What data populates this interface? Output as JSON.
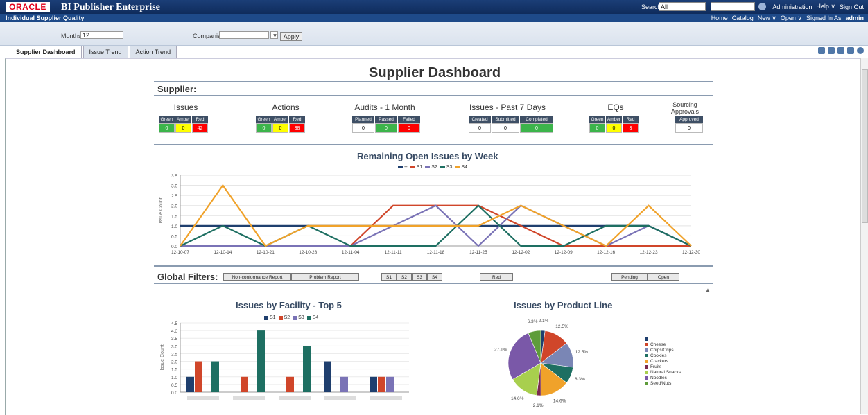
{
  "app": {
    "logo": "ORACLE",
    "product": "BI Publisher Enterprise",
    "search_label": "Search",
    "search_scope": "All",
    "top_links": [
      "Administration",
      "Help ∨",
      "Sign Out"
    ]
  },
  "report": {
    "title": "Individual Supplier Quality",
    "nav_links": [
      "Home",
      "Catalog",
      "New ∨",
      "Open ∨",
      "Signed In As"
    ],
    "user": "admin"
  },
  "params": {
    "months_label": "Months",
    "months_value": "12",
    "companies_label": "Companies",
    "apply_label": "Apply"
  },
  "tabs": [
    "Supplier Dashboard",
    "Issue Trend",
    "Action Trend"
  ],
  "dashboard": {
    "title": "Supplier Dashboard",
    "supplier_label": "Supplier:",
    "kpis": [
      {
        "title": "Issues",
        "heads": [
          "Green",
          "Amber",
          "Red"
        ],
        "values": [
          "0",
          "0",
          "42"
        ]
      },
      {
        "title": "Actions",
        "heads": [
          "Green",
          "Amber",
          "Red"
        ],
        "values": [
          "0",
          "0",
          "38"
        ]
      },
      {
        "title": "Audits - 1 Month",
        "heads": [
          "Planned",
          "Passed",
          "Failed"
        ],
        "values": [
          "0",
          "0",
          "0"
        ]
      },
      {
        "title": "Issues - Past 7 Days",
        "heads": [
          "Created",
          "Submitted",
          "Completed"
        ],
        "values": [
          "0",
          "0",
          "0"
        ]
      },
      {
        "title": "EQs",
        "heads": [
          "Green",
          "Amber",
          "Red"
        ],
        "values": [
          "0",
          "0",
          "3"
        ]
      },
      {
        "title": "Sourcing Approvals",
        "heads": [
          "Approved"
        ],
        "values": [
          "0"
        ]
      }
    ],
    "global_filters_label": "Global Filters:",
    "filters": [
      "Non-conformance Report",
      "Problem Report",
      "S1",
      "S2",
      "S3",
      "S4",
      "Red",
      "Pending",
      "Open"
    ]
  },
  "colors": {
    "s_blank": "#1f3f6e",
    "s1": "#d0462a",
    "s2": "#7a73b6",
    "s3": "#1e6f62",
    "s4": "#f0a22a"
  },
  "chart_data": [
    {
      "type": "line",
      "title": "Remaining Open Issues by Week",
      "ylabel": "Issue Count",
      "ylim": [
        0,
        3.5
      ],
      "yticks": [
        "0.0",
        "0.5",
        "1.0",
        "1.5",
        "2.0",
        "2.5",
        "3.0",
        "3.5"
      ],
      "categories": [
        "12-10-07",
        "12-10-14",
        "12-10-21",
        "12-10-28",
        "12-11-04",
        "12-11-11",
        "12-11-18",
        "12-11-25",
        "12-12-02",
        "12-12-09",
        "12-12-16",
        "12-12-23",
        "12-12-30"
      ],
      "series": [
        {
          "name": "--",
          "values": [
            1,
            1,
            1,
            1,
            1,
            1,
            1,
            1,
            1,
            1,
            1,
            1,
            0
          ]
        },
        {
          "name": "S1",
          "values": [
            0,
            0,
            0,
            0,
            0,
            2,
            2,
            2,
            1,
            0,
            0,
            0,
            0
          ]
        },
        {
          "name": "S2",
          "values": [
            0,
            0,
            0,
            0,
            0,
            1,
            2,
            0,
            2,
            1,
            0,
            1,
            0
          ]
        },
        {
          "name": "S3",
          "values": [
            0,
            1,
            0,
            1,
            0,
            0,
            0,
            2,
            0,
            0,
            1,
            1,
            0
          ]
        },
        {
          "name": "S4",
          "values": [
            0,
            3,
            0,
            1,
            1,
            1,
            1,
            1,
            2,
            1,
            0,
            2,
            0
          ]
        }
      ]
    },
    {
      "type": "bar",
      "title": "Issues by Facility - Top 5",
      "ylabel": "Issue Count",
      "ylim": [
        0,
        4.5
      ],
      "yticks": [
        "0.0",
        "0.5",
        "1.0",
        "1.5",
        "2.0",
        "2.5",
        "3.0",
        "3.5",
        "4.0",
        "4.5"
      ],
      "categories": [
        "",
        "",
        "",
        "",
        ""
      ],
      "series": [
        {
          "name": "S1",
          "values": [
            1,
            0,
            0,
            2,
            1
          ]
        },
        {
          "name": "S2",
          "values": [
            2,
            1,
            1,
            0,
            1
          ]
        },
        {
          "name": "S3",
          "values": [
            0,
            0,
            0,
            1,
            1
          ]
        },
        {
          "name": "S4",
          "values": [
            2,
            4,
            3,
            0,
            0
          ]
        }
      ]
    },
    {
      "type": "pie",
      "title": "Issues by Product Line",
      "labels": [
        "",
        "Cheese",
        "Chips/Crips",
        "Cookies",
        "Crackers",
        "Fruits",
        "Natural Snacks",
        "Noodles",
        "Seed/Nuts"
      ],
      "values": [
        2.1,
        12.5,
        12.5,
        8.3,
        14.6,
        2.1,
        14.6,
        27.1,
        6.3
      ],
      "value_labels": [
        "2.1%",
        "12.5%",
        "12.5%",
        "8.3%",
        "14.6%",
        "2.1%",
        "14.6%",
        "27.1%",
        "6.3%"
      ],
      "colors": [
        "#1f3f6e",
        "#d0462a",
        "#7a86b5",
        "#1e6f62",
        "#f0a22a",
        "#7a2a4f",
        "#a8cf4e",
        "#7a58a8",
        "#5e9c3a"
      ]
    }
  ]
}
